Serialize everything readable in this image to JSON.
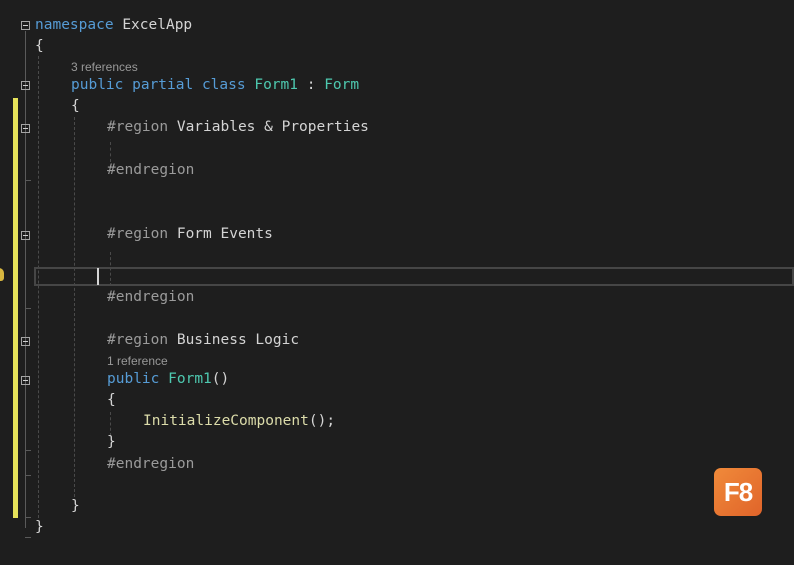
{
  "lines": {
    "namespace_kw": "namespace",
    "namespace_name": "ExcelApp",
    "ns_open_brace": "{",
    "class_refs": "3 references",
    "class_modifiers": "public partial class",
    "class_name": "Form1",
    "class_colon": " : ",
    "class_base": "Form",
    "class_open_brace": "{",
    "region1_kw": "#region",
    "region1_name": "Variables & Properties",
    "endregion1": "#endregion",
    "region2_kw": "#region",
    "region2_name": "Form Events",
    "endregion2": "#endregion",
    "region3_kw": "#region",
    "region3_name": "Business Logic",
    "ctor_refs": "1 reference",
    "ctor_modifier": "public",
    "ctor_name": "Form1",
    "ctor_parens": "()",
    "ctor_open_brace": "{",
    "call_name": "InitializeComponent",
    "call_tail": "();",
    "ctor_close_brace": "}",
    "endregion3": "#endregion",
    "class_close_brace": "}",
    "ns_close_brace": "}"
  },
  "badge": {
    "label": "F8",
    "color": "#e86f2e"
  },
  "colors": {
    "background": "#1e1e1e",
    "keyword": "#569cd6",
    "type": "#4ec9b0",
    "method": "#dcdcaa",
    "preprocessor": "#9b9b9b",
    "change_bar": "#e6e25a"
  }
}
